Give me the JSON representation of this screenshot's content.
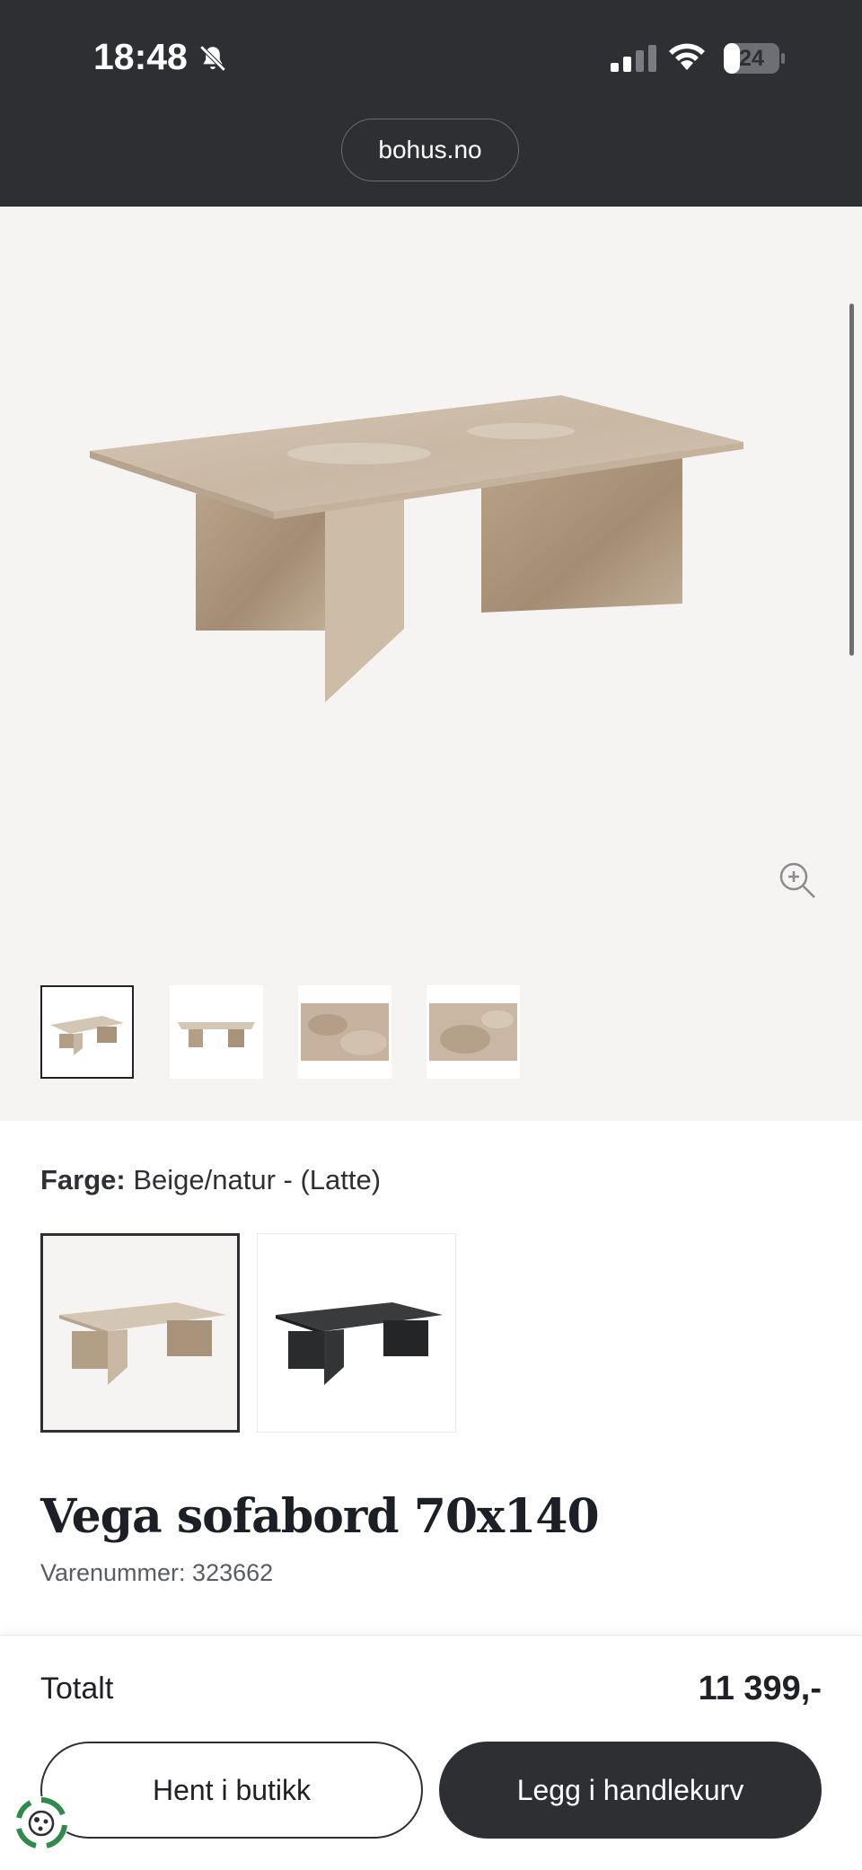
{
  "status_bar": {
    "time": "18:48",
    "battery": "24"
  },
  "browser": {
    "url": "bohus.no"
  },
  "gallery": {
    "thumbnails": [
      "table-front",
      "table-side",
      "marble-detail-1",
      "marble-detail-2"
    ],
    "selected_index": 0
  },
  "colour": {
    "label": "Farge:",
    "value": "Beige/natur - (Latte)"
  },
  "swatches": [
    {
      "name": "beige",
      "selected": true
    },
    {
      "name": "black",
      "selected": false
    }
  ],
  "product": {
    "title": "Vega sofabord 70x140",
    "sku": "Varenummer: 323662"
  },
  "footer": {
    "total_label": "Totalt",
    "total_value": "11 399,-",
    "pickup_label": "Hent i butikk",
    "cart_label": "Legg i handlekurv"
  },
  "colors": {
    "dark": "#2e2f33",
    "gallery_bg": "#f6f4f2",
    "marble": "#cbbba8"
  }
}
